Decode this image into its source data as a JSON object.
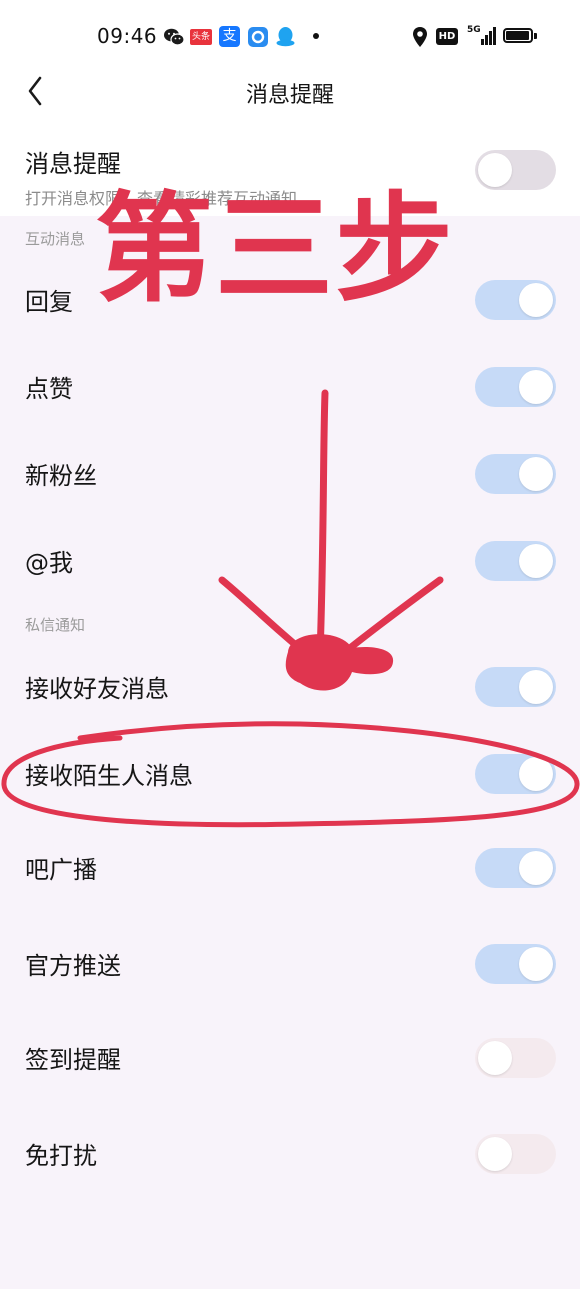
{
  "status_bar": {
    "time": "09:46",
    "left_icons": [
      "wechat-icon",
      "toutiao-icon",
      "alipay-icon",
      "app-circle-icon",
      "qq-icon",
      "dot-icon"
    ],
    "toutiao_label": "头条",
    "alipay_label": "支",
    "hd_label": "HD",
    "network_label": "5G",
    "right_icons": [
      "location-icon",
      "hd-icon",
      "signal-5g-icon",
      "battery-icon"
    ]
  },
  "nav": {
    "title": "消息提醒",
    "back_icon": "chevron-left-icon"
  },
  "master": {
    "label": "消息提醒",
    "description": "打开消息权限，查看精彩推荐互动通知",
    "state": "off"
  },
  "sections": {
    "interaction": "互动消息",
    "private": "私信通知"
  },
  "settings": [
    {
      "id": "reply",
      "label": "回复",
      "state": "on"
    },
    {
      "id": "like",
      "label": "点赞",
      "state": "on"
    },
    {
      "id": "new-fans",
      "label": "新粉丝",
      "state": "on"
    },
    {
      "id": "mention",
      "label": "@我",
      "state": "on"
    },
    {
      "id": "friend-msg",
      "label": "接收好友消息",
      "state": "on"
    },
    {
      "id": "stranger-msg",
      "label": "接收陌生人消息",
      "state": "on"
    },
    {
      "id": "bar-broadcast",
      "label": "吧广播",
      "state": "on"
    },
    {
      "id": "official-push",
      "label": "官方推送",
      "state": "on"
    },
    {
      "id": "checkin-reminder",
      "label": "签到提醒",
      "state": "off"
    },
    {
      "id": "do-not-disturb",
      "label": "免打扰",
      "state": "off"
    }
  ],
  "annotation": {
    "text": "第三步",
    "color": "#e0354f"
  },
  "colors": {
    "panel_background": "#f8f3fa",
    "toggle_on": "#c6daf7",
    "toggle_off": "#e3dde4",
    "annotation_red": "#e0354f"
  }
}
